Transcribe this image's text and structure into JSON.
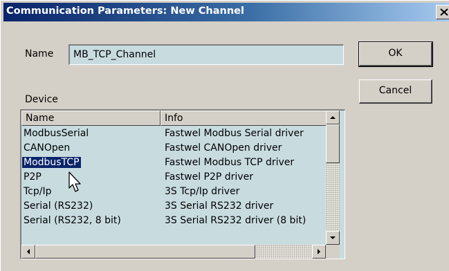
{
  "window": {
    "title": "Communication Parameters: New Channel",
    "close_glyph": "✕"
  },
  "form": {
    "name_label": "Name",
    "name_value": "MB_TCP_Channel",
    "device_label": "Device"
  },
  "buttons": {
    "ok_label": "OK",
    "cancel_label": "Cancel"
  },
  "device_list": {
    "columns": [
      "Name",
      "Info"
    ],
    "rows": [
      {
        "name": "ModbusSerial",
        "info": "Fastwel Modbus Serial driver"
      },
      {
        "name": "CANOpen",
        "info": "Fastwel CANOpen driver"
      },
      {
        "name": "ModbusTCP",
        "info": "Fastwel Modbus TCP driver",
        "selected": true
      },
      {
        "name": "P2P",
        "info": "Fastwel P2P driver"
      },
      {
        "name": "Tcp/Ip",
        "info": "3S Tcp/Ip driver"
      },
      {
        "name": "Serial (RS232)",
        "info": "3S Serial RS232 driver"
      },
      {
        "name": "Serial (RS232, 8 bit)",
        "info": "3S Serial RS232 driver (8 bit)"
      }
    ]
  },
  "colors": {
    "titlebar_start": "#0a246a",
    "titlebar_end": "#a6caf0",
    "face": "#d4d0c8",
    "field_bg": "#c8dce0",
    "selection": "#0a246a"
  },
  "icons": {
    "close": "close-icon",
    "scroll_up": "arrow-up-icon",
    "scroll_down": "arrow-down-icon",
    "scroll_left": "arrow-left-icon",
    "scroll_right": "arrow-right-icon",
    "cursor": "mouse-pointer-icon"
  }
}
